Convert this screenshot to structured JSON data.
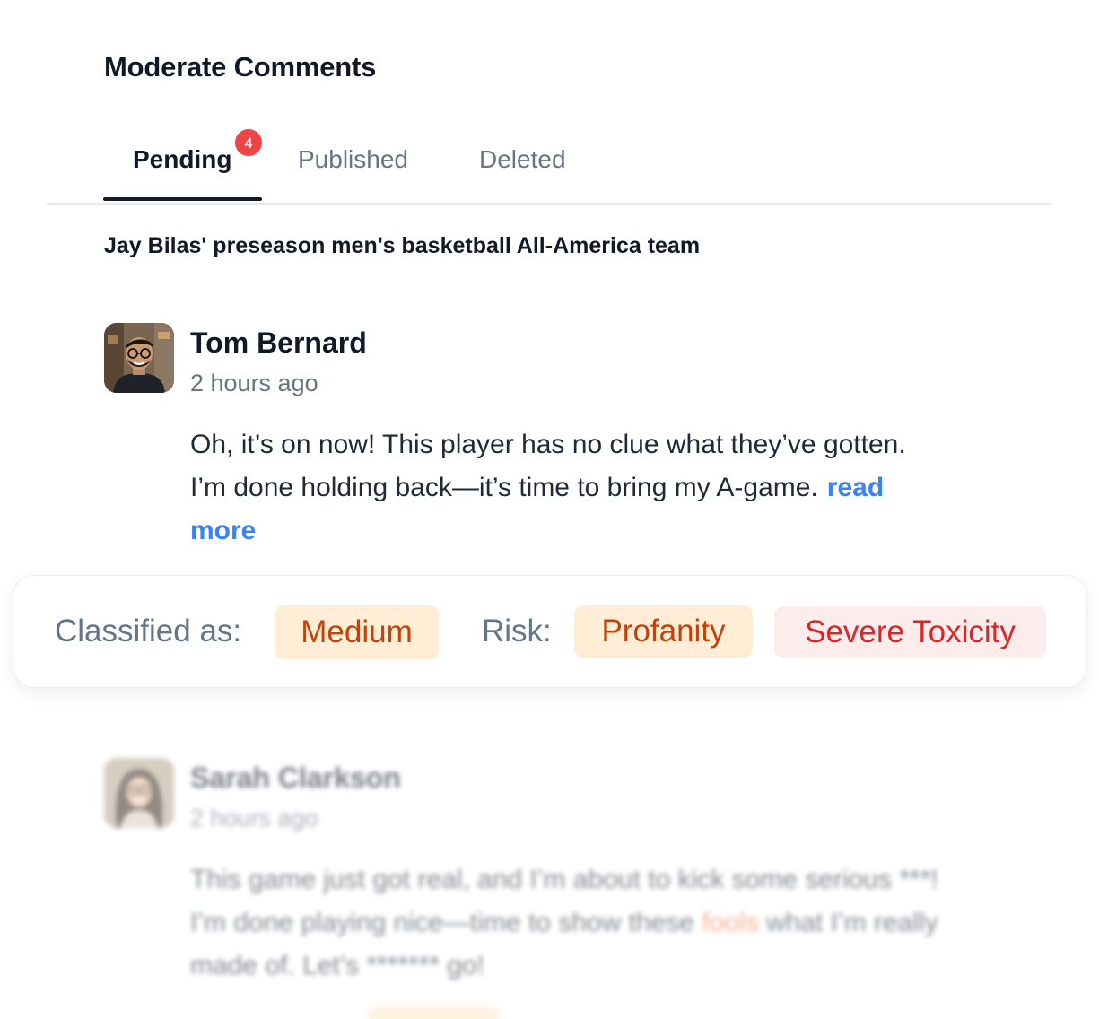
{
  "page": {
    "title": "Moderate Comments"
  },
  "tabs": [
    {
      "label": "Pending",
      "badge": "4",
      "active": true
    },
    {
      "label": "Published",
      "active": false
    },
    {
      "label": "Deleted",
      "active": false
    }
  ],
  "article": {
    "title": "Jay Bilas' preseason men's basketball All-America team"
  },
  "comments": [
    {
      "author": "Tom Bernard",
      "timestamp": "2 hours ago",
      "avatar_icon": "avatar-man-glasses",
      "text": "Oh, it’s on now! This player has no clue what they’ve gotten. I’m done holding back—it’s time to bring my A-game.",
      "read_more": "read more"
    },
    {
      "author": "Sarah Clarkson",
      "timestamp": "2 hours ago",
      "avatar_icon": "avatar-woman-glasses",
      "text_start": "This game just got real, and I’m about to kick some serious ***! I’m done playing nice—time to show these ",
      "flagged_word": "fools",
      "text_end": " what I’m really made of. Let’s ******* go!"
    }
  ],
  "classification": {
    "label": "Classified as:",
    "level": "Medium",
    "risk_label": "Risk:",
    "risks": [
      "Profanity",
      "Severe Toxicity"
    ]
  },
  "colors": {
    "badge": "#ef4444",
    "link": "#3b82f6",
    "chip_orange_bg": "#ffedd5",
    "chip_orange_text": "#c2410c",
    "chip_red_bg": "#fdecec",
    "chip_red_text": "#dc2626"
  }
}
